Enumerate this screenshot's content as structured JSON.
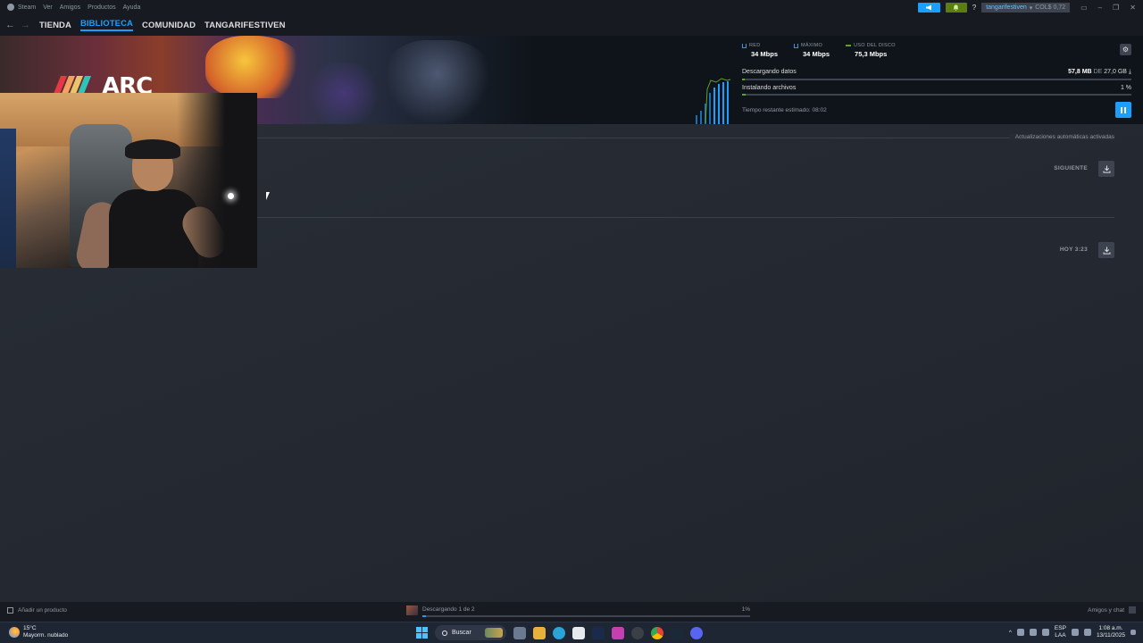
{
  "menu": {
    "items": [
      "Steam",
      "Ver",
      "Amigos",
      "Productos",
      "Ayuda"
    ]
  },
  "account": {
    "username": "tangarifestiven",
    "wallet": "COL$ 0,72",
    "help": "?"
  },
  "nav": {
    "tabs": [
      "TIENDA",
      "BIBLIOTECA",
      "COMUNIDAD",
      "TANGARIFESTIVEN"
    ],
    "active": "BIBLIOTECA"
  },
  "hero": {
    "game_logo": "ARC",
    "stats": [
      {
        "label": "RED",
        "value": "34 Mbps"
      },
      {
        "label": "MÁXIMO",
        "value": "34 Mbps"
      },
      {
        "label": "USO DEL DISCO",
        "value": "75,3 Mbps"
      }
    ],
    "download": {
      "label": "Descargando datos",
      "done": "57,8 MB",
      "of": "DE",
      "total": "27,0 GB",
      "progress": 0.002
    },
    "install": {
      "label": "Instalando archivos",
      "percent_text": "1 %",
      "progress": 0.01
    },
    "eta": "Tiempo restante estimado: 08:02"
  },
  "content": {
    "auto_updates": "Actualizaciones automáticas activadas",
    "sections": [
      {
        "label": "SIGUIENTE"
      },
      {
        "label": "HOY 3:23"
      }
    ]
  },
  "statusbar": {
    "add_product": "Añadir un producto",
    "downloading": "Descargando 1 de 2",
    "percent": "1%",
    "progress": 0.01,
    "friends": "Amigos y chat"
  },
  "taskbar": {
    "temp": "15°C",
    "weather": "Mayorm. nublado",
    "search": "Buscar",
    "lang": "ESP",
    "layout": "LAA",
    "time": "1:08 a.m.",
    "date": "13/11/2025"
  },
  "colors": {
    "accent": "#1a9fff",
    "green": "#5ba32b",
    "bg": "#1b2028"
  },
  "icons": [
    "steam-icon",
    "back-arrow-icon",
    "forward-arrow-icon",
    "megaphone-icon",
    "bell-icon",
    "gear-icon",
    "pause-icon",
    "download-icon",
    "add-icon",
    "chat-icon",
    "windows-start-icon",
    "search-icon"
  ]
}
